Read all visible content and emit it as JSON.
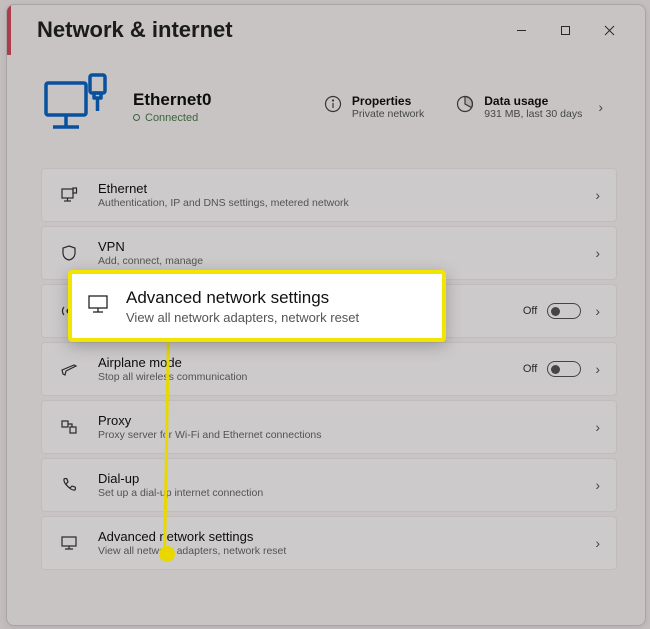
{
  "titlebar": {
    "title": "Network & internet"
  },
  "connection": {
    "name": "Ethernet0",
    "status": "Connected"
  },
  "stats": {
    "properties": {
      "title": "Properties",
      "sub": "Private network"
    },
    "data_usage": {
      "title": "Data usage",
      "sub": "931 MB, last 30 days"
    }
  },
  "rows": {
    "ethernet": {
      "title": "Ethernet",
      "sub": "Authentication, IP and DNS settings, metered network"
    },
    "vpn": {
      "title": "VPN",
      "sub": "Add, connect, manage"
    },
    "hotspot": {
      "title": "Advanced network settings",
      "sub": "View all network adapters, network reset",
      "toggle": "Off"
    },
    "airplane": {
      "title": "Airplane mode",
      "sub": "Stop all wireless communication",
      "toggle": "Off"
    },
    "proxy": {
      "title": "Proxy",
      "sub": "Proxy server for Wi-Fi and Ethernet connections"
    },
    "dialup": {
      "title": "Dial-up",
      "sub": "Set up a dial-up internet connection"
    },
    "advanced": {
      "title": "Advanced network settings",
      "sub": "View all network adapters, network reset"
    }
  },
  "popup": {
    "title": "Advanced network settings",
    "sub": "View all network adapters, network reset"
  }
}
